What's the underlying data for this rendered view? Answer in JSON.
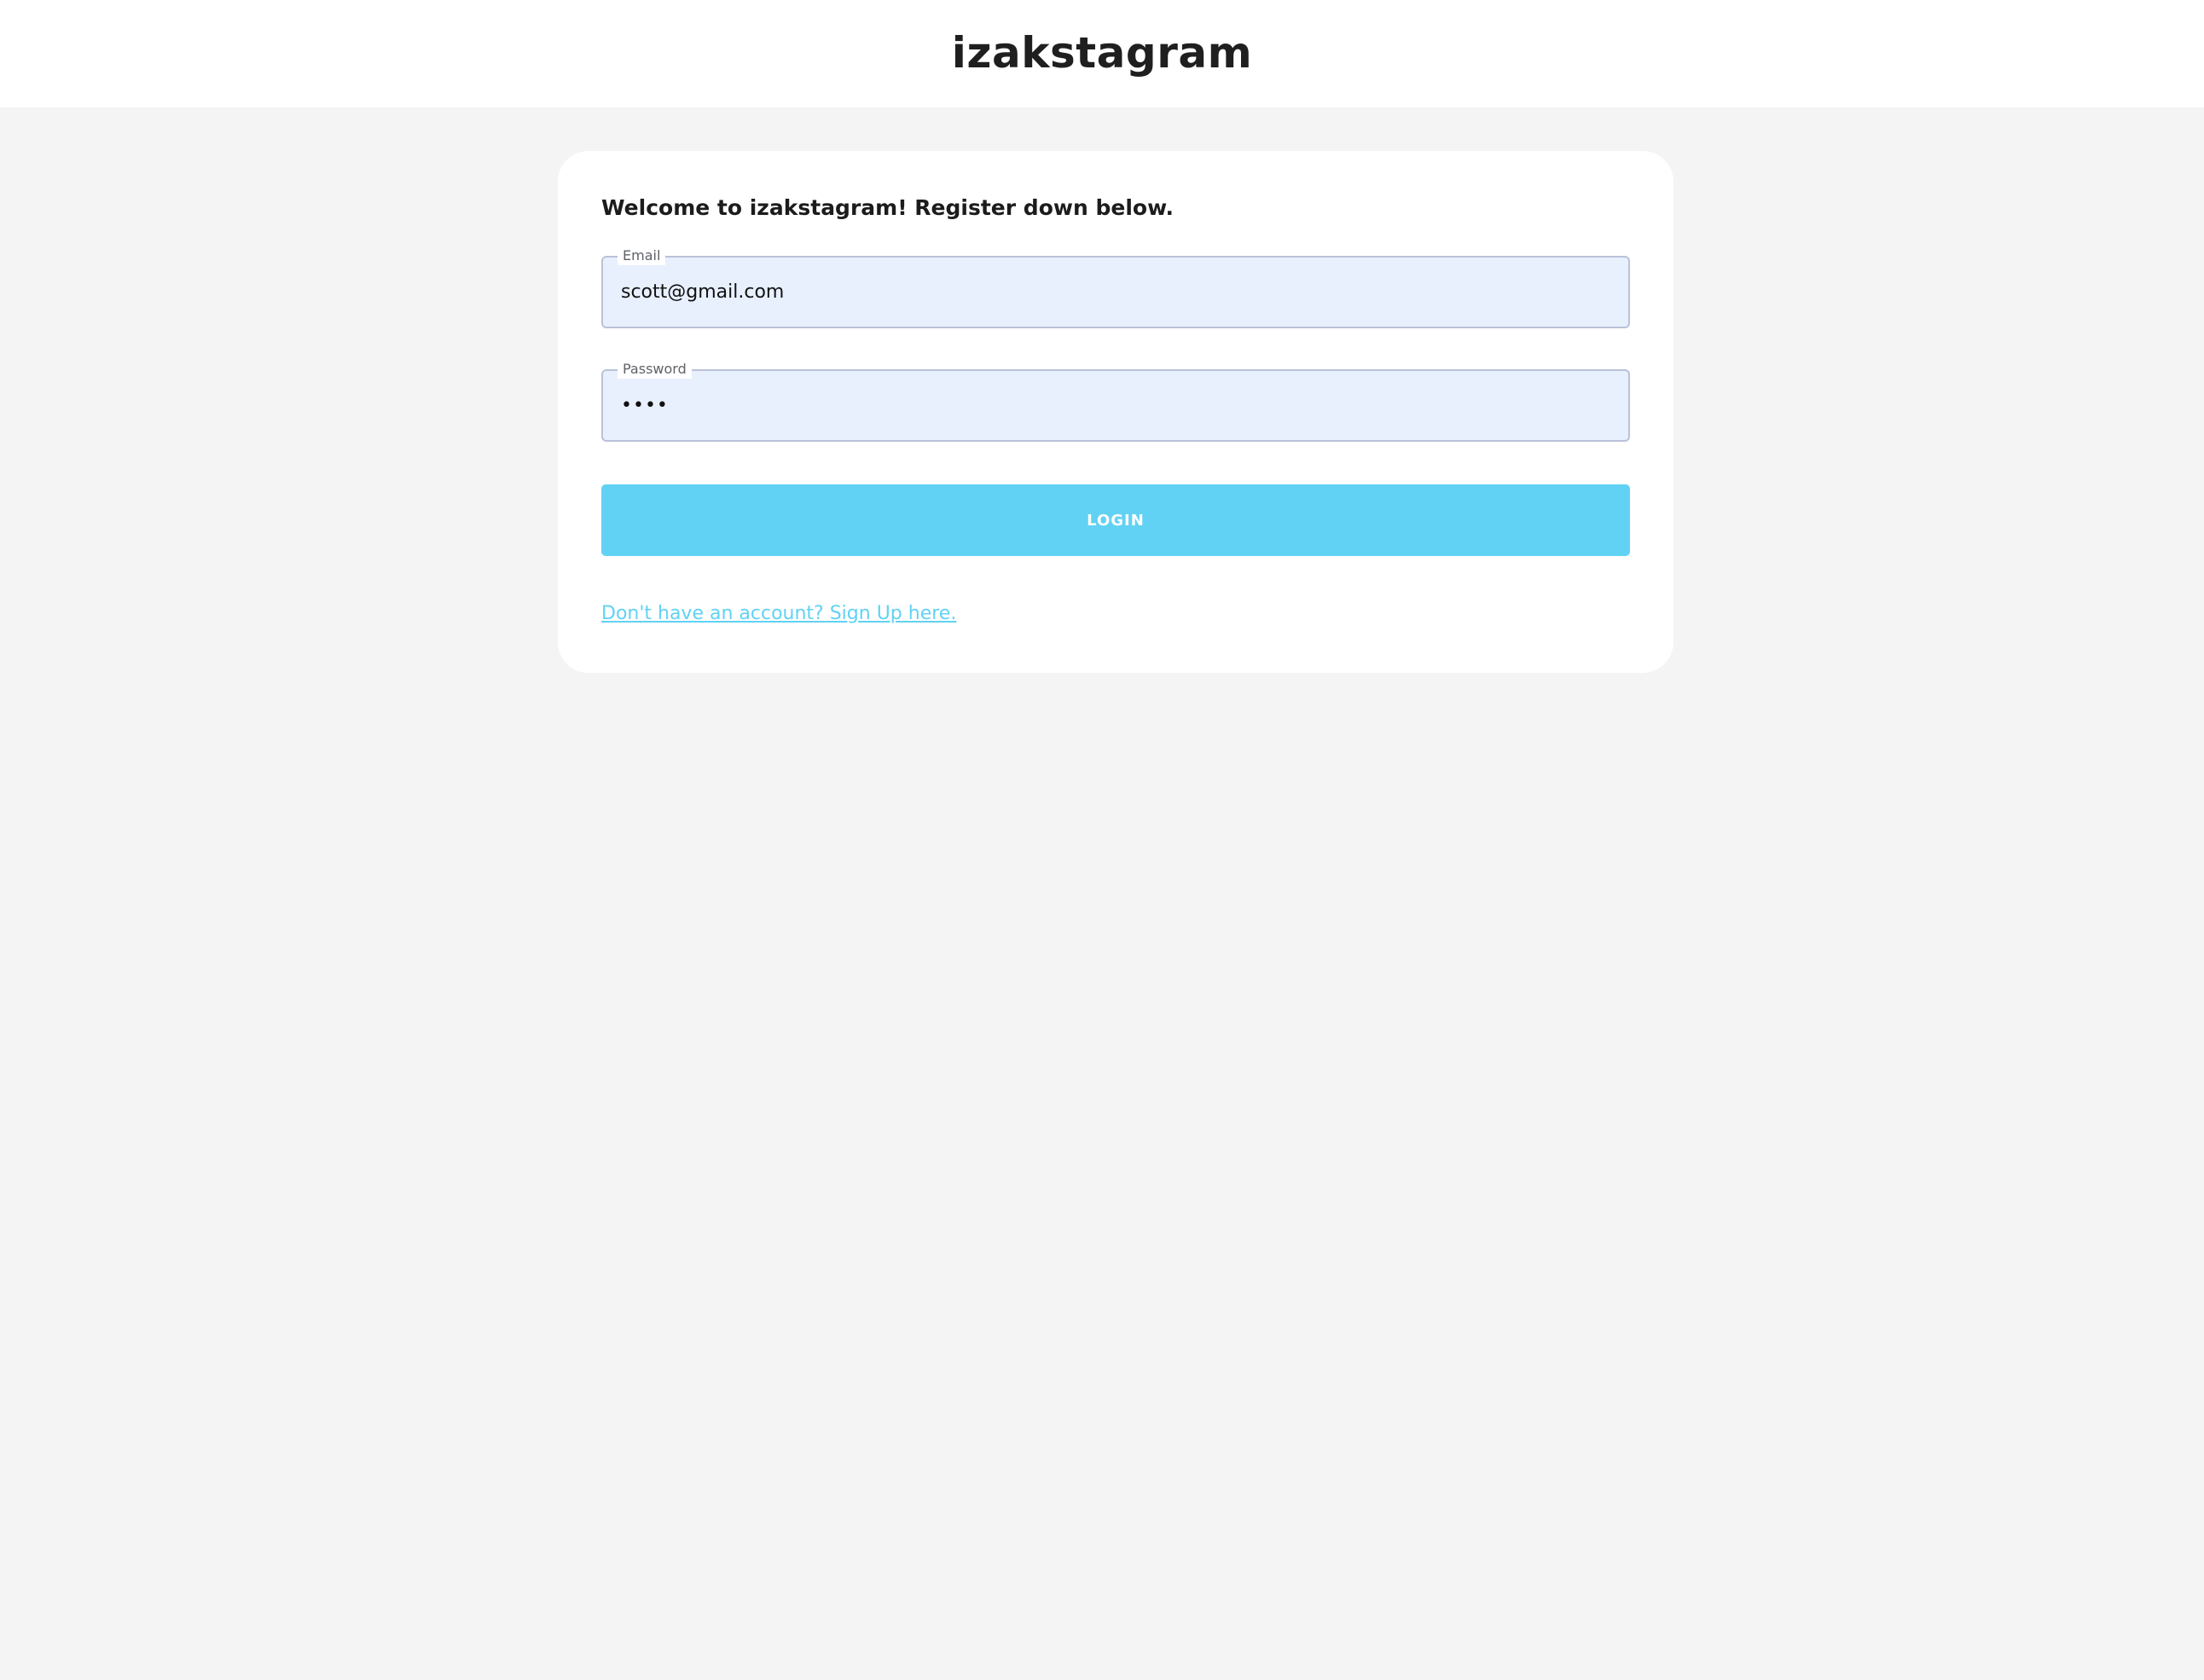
{
  "header": {
    "brand": "izakstagram"
  },
  "login_form": {
    "heading": "Welcome to izakstagram! Register down below.",
    "email": {
      "label": "Email",
      "value": "scott@gmail.com"
    },
    "password": {
      "label": "Password",
      "value": "••••"
    },
    "login_button_label": "LOGIN",
    "signup_link_text": "Don't have an account? Sign Up here."
  },
  "colors": {
    "accent": "#61d2f4",
    "page_background": "#f4f4f4",
    "input_background": "#e8f0fe"
  }
}
